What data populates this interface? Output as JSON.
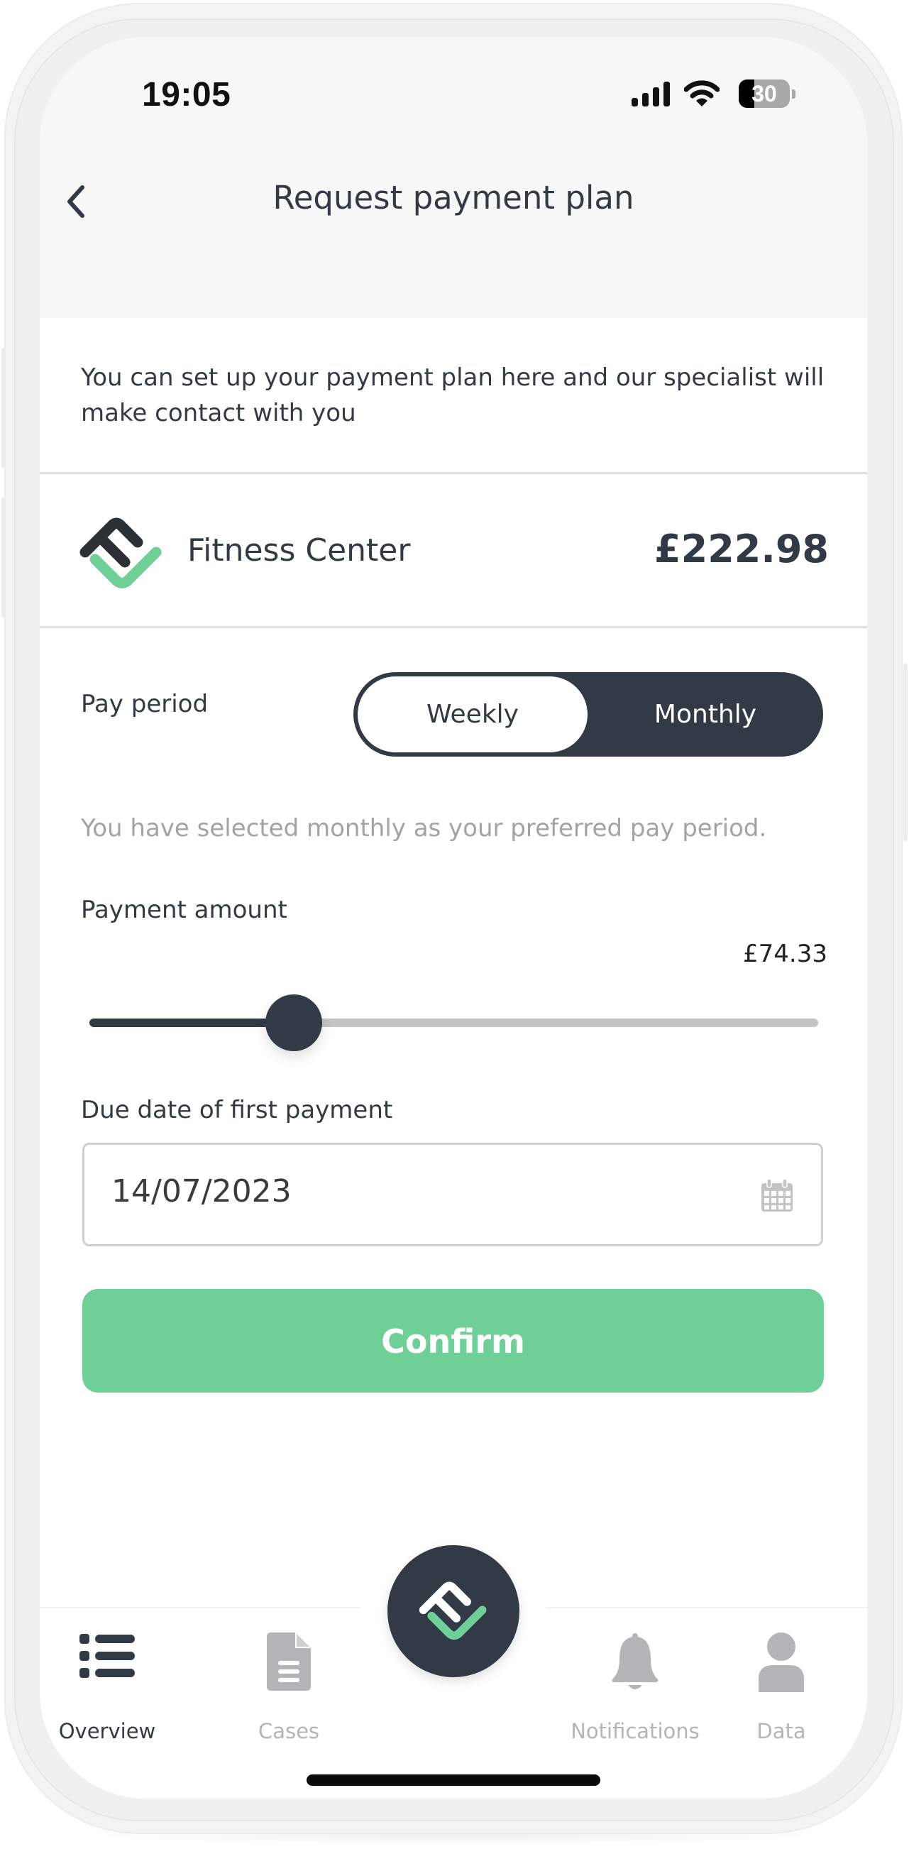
{
  "status_bar": {
    "time": "19:05",
    "battery": "30",
    "icons": [
      "cellular-signal-icon",
      "wifi-icon",
      "battery-icon"
    ]
  },
  "header": {
    "title": "Request payment plan",
    "back_icon": "chevron-left-icon"
  },
  "intro_text": "You can set up your payment plan here and our specialist will make contact with you",
  "merchant": {
    "name": "Fitness Center",
    "amount": "£222.98",
    "logo_icon": "brand-logo-icon"
  },
  "pay_period": {
    "label": "Pay period",
    "options": [
      "Weekly",
      "Monthly"
    ],
    "selected": "Monthly",
    "hint": "You have selected monthly as your preferred pay period."
  },
  "payment_amount": {
    "label": "Payment amount",
    "value": "£74.33",
    "slider_fraction": 0.28
  },
  "due_date": {
    "label": "Due date of first payment",
    "value": "14/07/2023",
    "icon": "calendar-icon"
  },
  "confirm_label": "Confirm",
  "colors": {
    "primary_dark": "#323a46",
    "accent_green": "#6ecf97",
    "muted_text": "#a3a3a3",
    "inactive_nav": "#b5b5b7"
  },
  "bottom_nav": {
    "items": [
      {
        "label": "Overview",
        "icon": "list-icon",
        "active": true
      },
      {
        "label": "Cases",
        "icon": "document-icon",
        "active": false
      },
      {
        "label": "Notifications",
        "icon": "bell-icon",
        "active": false
      },
      {
        "label": "Data",
        "icon": "user-icon",
        "active": false
      }
    ],
    "center_button_icon": "brand-logo-icon"
  }
}
